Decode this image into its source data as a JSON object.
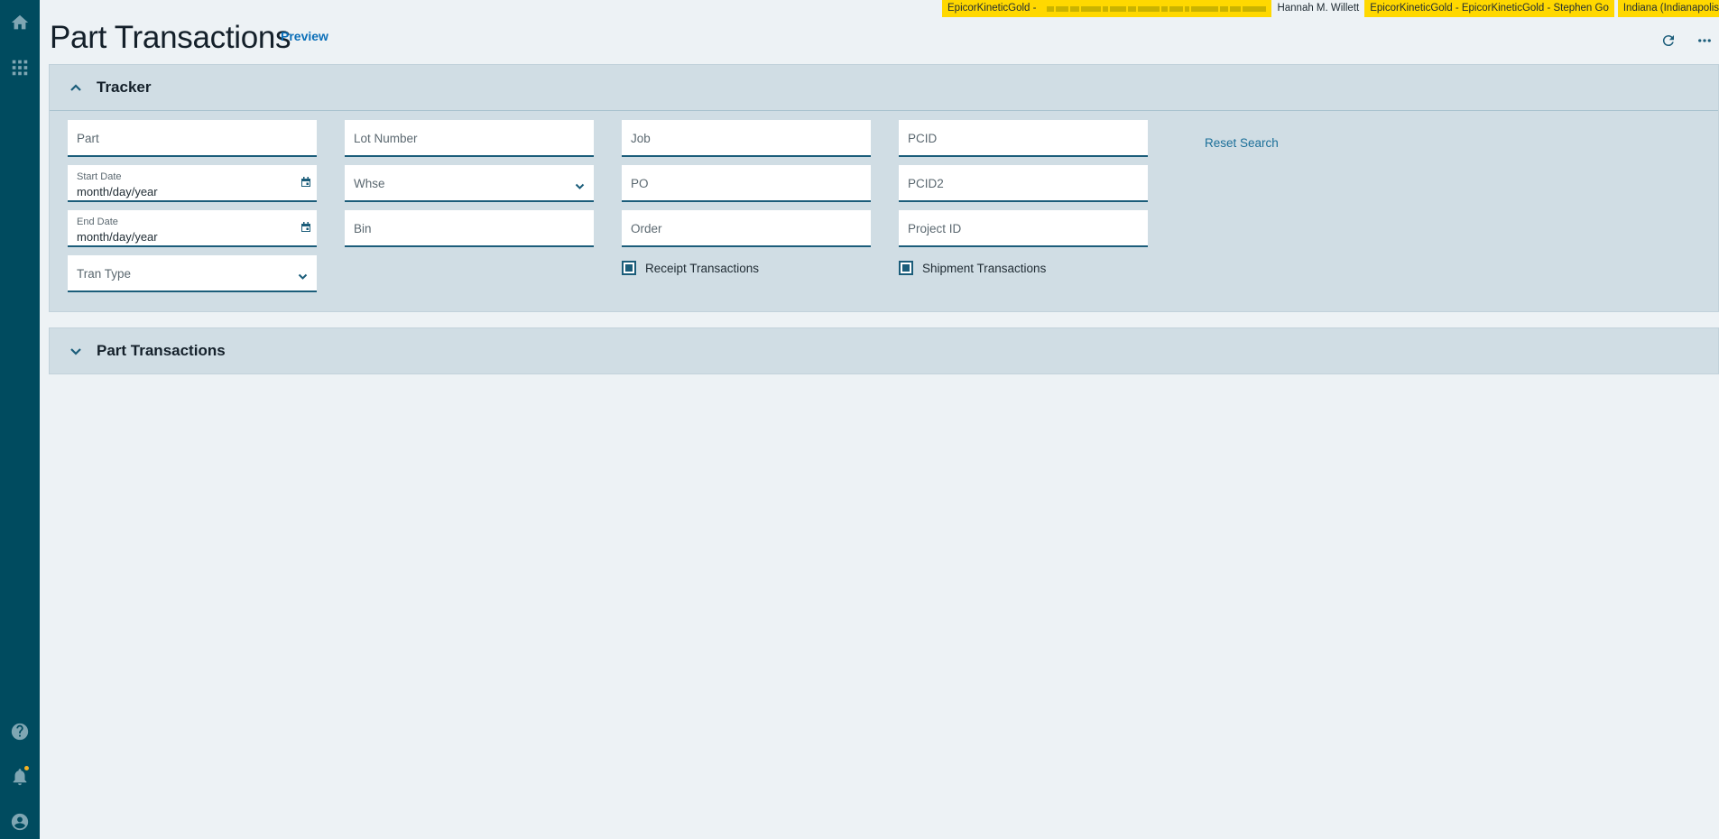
{
  "environment_bar": {
    "company": "EpicorKineticGold -",
    "user": "Hannah M. Willett",
    "session": "EpicorKineticGold - EpicorKineticGold - Stephen Go",
    "site": "Indiana (Indianapolis"
  },
  "header": {
    "title": "Part Transactions",
    "preview_label": "Preview"
  },
  "tracker": {
    "title": "Tracker",
    "fields": {
      "part": "Part",
      "start_date_label": "Start Date",
      "start_date_value": "month/day/year",
      "end_date_label": "End Date",
      "end_date_value": "month/day/year",
      "tran_type": "Tran Type",
      "lot_number": "Lot Number",
      "whse": "Whse",
      "bin": "Bin",
      "job": "Job",
      "po": "PO",
      "order": "Order",
      "pcid": "PCID",
      "pcid2": "PCID2",
      "project_id": "Project ID"
    },
    "checkboxes": {
      "receipt_label": "Receipt Transactions",
      "receipt_checked": true,
      "shipment_label": "Shipment Transactions",
      "shipment_checked": true
    },
    "reset_label": "Reset Search"
  },
  "part_transactions_panel": {
    "title": "Part Transactions"
  },
  "icons": [
    "home-icon",
    "apps-grid-icon",
    "help-icon",
    "bell-icon",
    "user-icon",
    "refresh-icon",
    "more-icon",
    "chevron-up-icon",
    "chevron-down-icon",
    "calendar-icon"
  ],
  "colors": {
    "sidebar": "#004b5f",
    "accent": "#1b5d7a",
    "environment_highlight": "#ffd800",
    "notification_dot": "#f4b223"
  }
}
